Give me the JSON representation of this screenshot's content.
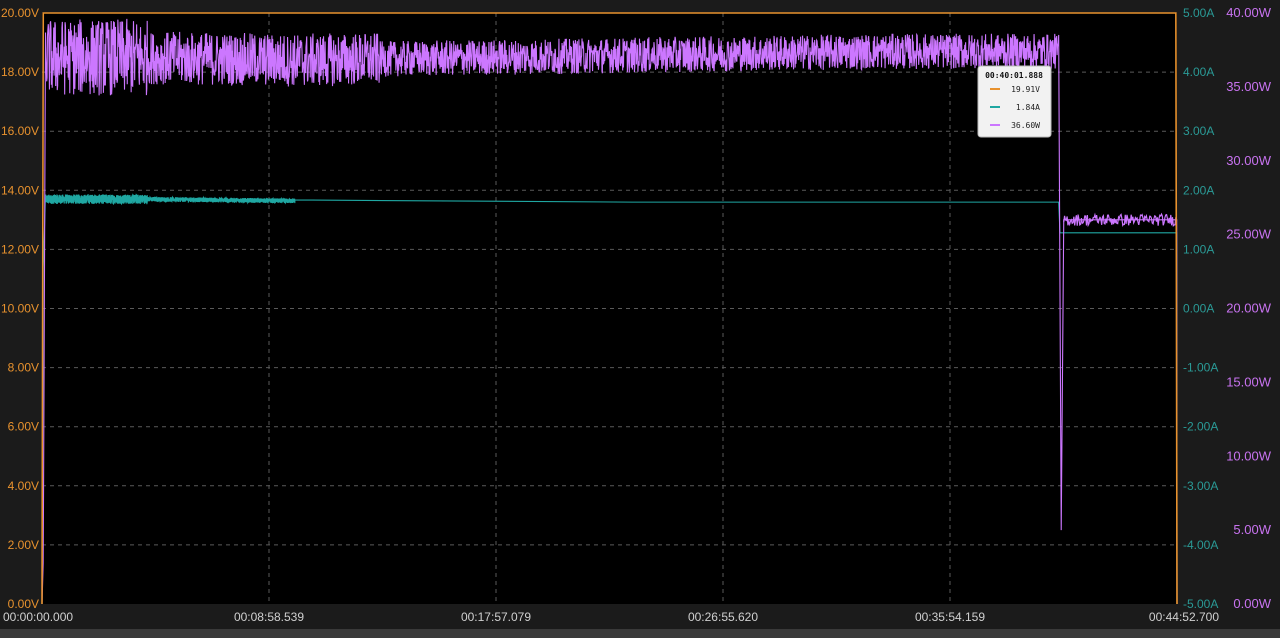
{
  "chart_data": {
    "type": "line",
    "grid": true,
    "x": {
      "ticks": [
        "00:00:00.000",
        "00:08:58.539",
        "00:17:57.079",
        "00:26:55.620",
        "00:35:54.159",
        "00:44:52.700"
      ],
      "range_seconds": [
        0,
        2692.7
      ]
    },
    "axes": {
      "voltage": {
        "position": "left",
        "range": [
          0,
          20
        ],
        "unit": "V",
        "ticks": [
          "0.00V",
          "2.00V",
          "4.00V",
          "6.00V",
          "8.00V",
          "10.00V",
          "12.00V",
          "14.00V",
          "16.00V",
          "18.00V",
          "20.00V"
        ]
      },
      "current": {
        "position": "right-inner",
        "range": [
          -5,
          5
        ],
        "unit": "A",
        "ticks": [
          "-5.00A",
          "-4.00A",
          "-3.00A",
          "-2.00A",
          "-1.00A",
          "0.00A",
          "1.00A",
          "2.00A",
          "3.00A",
          "4.00A",
          "5.00A"
        ]
      },
      "power": {
        "position": "right-outer",
        "range": [
          0,
          40
        ],
        "unit": "W",
        "ticks": [
          "0.00W",
          "5.00W",
          "10.00W",
          "15.00W",
          "20.00W",
          "25.00W",
          "30.00W",
          "35.00W",
          "40.00W"
        ]
      }
    },
    "series": [
      {
        "axis": "voltage",
        "color": "#e8922e",
        "points": [
          [
            0,
            0
          ],
          [
            3,
            20
          ],
          [
            2690,
            20
          ],
          [
            2692.7,
            0
          ]
        ]
      },
      {
        "axis": "current",
        "color": "#1fa7a2",
        "points": [
          [
            0,
            -5
          ],
          [
            3,
            0.7
          ],
          [
            8,
            1.85
          ],
          [
            250,
            1.85
          ],
          [
            600,
            1.82
          ],
          [
            1400,
            1.8
          ],
          [
            2200,
            1.8
          ],
          [
            2412,
            1.8
          ],
          [
            2415,
            1.28
          ],
          [
            2692,
            1.28
          ],
          [
            2692.7,
            -5
          ]
        ],
        "noise_until": 600
      },
      {
        "axis": "power",
        "color": "#cc77ff",
        "points": [
          [
            0,
            0
          ],
          [
            3,
            3
          ],
          [
            8,
            37
          ],
          [
            200,
            37
          ],
          [
            600,
            36.8
          ],
          [
            2000,
            37.4
          ],
          [
            2412,
            37.4
          ],
          [
            2418,
            5
          ],
          [
            2424,
            26
          ],
          [
            2692,
            26
          ],
          [
            2692.7,
            0
          ]
        ],
        "noise_until": 2412
      }
    ],
    "tooltip": {
      "time": "00:40:01.888",
      "entries": [
        {
          "value": "19.91V",
          "color": "#e8922e"
        },
        {
          "value": "1.84A",
          "color": "#1fa7a2"
        },
        {
          "value": "36.60W",
          "color": "#cc77ff"
        }
      ]
    }
  }
}
